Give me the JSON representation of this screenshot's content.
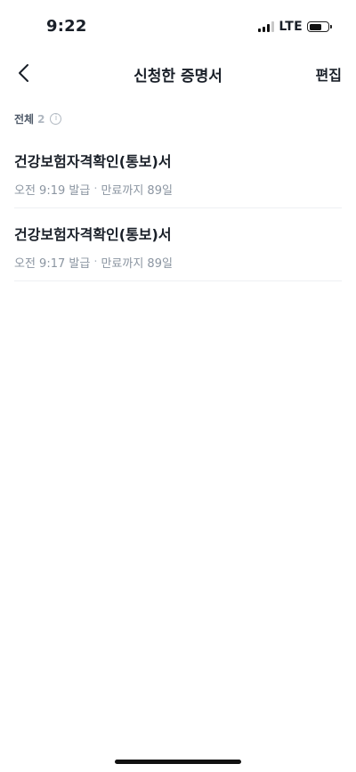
{
  "status_bar": {
    "time": "9:22",
    "network": "LTE",
    "battery_level": 0.65
  },
  "nav": {
    "title": "신청한 증명서",
    "edit_label": "편집",
    "back_icon": "chevron-left-icon"
  },
  "summary": {
    "label": "전체",
    "count": "2",
    "info_icon": "ⓘ"
  },
  "certificates": [
    {
      "title": "건강보험자격확인(통보)서",
      "issued": "오전 9:19 발급",
      "separator": "·",
      "expiry": "만료까지 89일"
    },
    {
      "title": "건강보험자격확인(통보)서",
      "issued": "오전 9:17 발급",
      "separator": "·",
      "expiry": "만료까지 89일"
    }
  ],
  "colors": {
    "text": "#191f28",
    "sub_text": "#8b95a1",
    "divider": "#eef0f3"
  }
}
